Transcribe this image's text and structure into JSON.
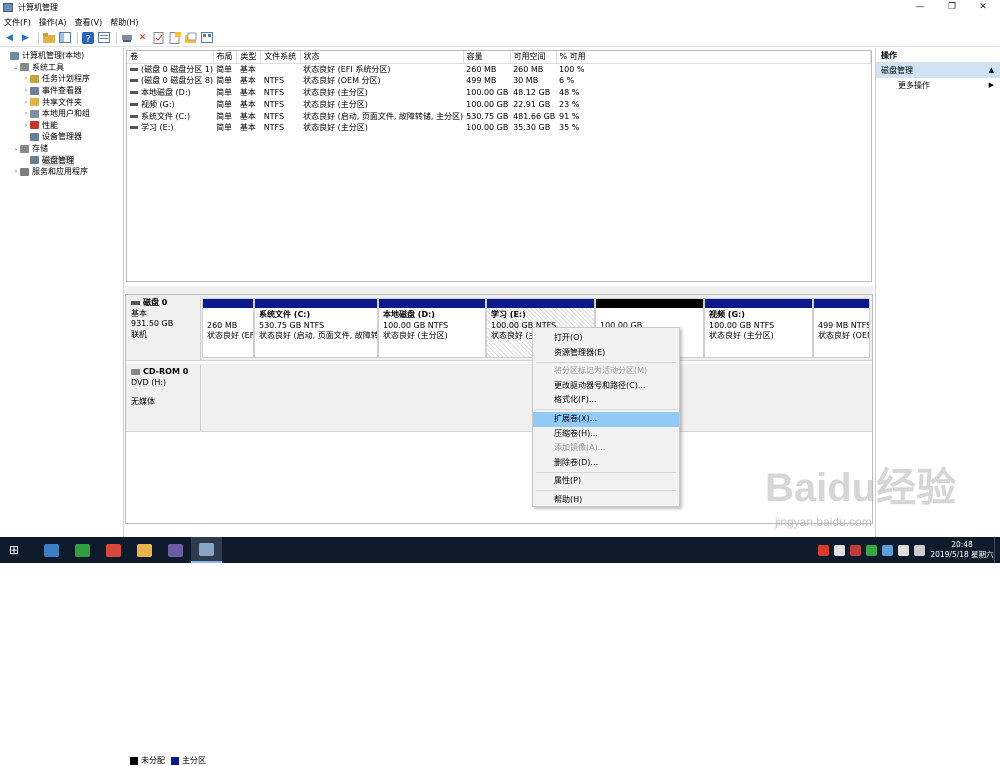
{
  "window": {
    "title": "计算机管理"
  },
  "window_controls": {
    "minimize": "—",
    "maximize": "❐",
    "close": "✕"
  },
  "menu": [
    "文件(F)",
    "操作(A)",
    "查看(V)",
    "帮助(H)"
  ],
  "tree": [
    {
      "label": "计算机管理(本地)",
      "indent": 0,
      "twisty": "",
      "icon": "computer-icon",
      "color": "#6f8aa6"
    },
    {
      "label": "系统工具",
      "indent": 1,
      "twisty": "⌄",
      "icon": "tools-icon",
      "color": "#8a8a8a"
    },
    {
      "label": "任务计划程序",
      "indent": 2,
      "twisty": "›",
      "icon": "clock-icon",
      "color": "#c9a23a"
    },
    {
      "label": "事件查看器",
      "indent": 2,
      "twisty": "›",
      "icon": "event-icon",
      "color": "#6d7f99"
    },
    {
      "label": "共享文件夹",
      "indent": 2,
      "twisty": "›",
      "icon": "folder-icon",
      "color": "#e2b34a"
    },
    {
      "label": "本地用户和组",
      "indent": 2,
      "twisty": "›",
      "icon": "users-icon",
      "color": "#7f8f9f"
    },
    {
      "label": "性能",
      "indent": 2,
      "twisty": "›",
      "icon": "performance-icon",
      "color": "#c0392b"
    },
    {
      "label": "设备管理器",
      "indent": 2,
      "twisty": "",
      "icon": "device-icon",
      "color": "#5f7f9f"
    },
    {
      "label": "存储",
      "indent": 1,
      "twisty": "⌄",
      "icon": "storage-icon",
      "color": "#8a8a8a"
    },
    {
      "label": "磁盘管理",
      "indent": 2,
      "twisty": "",
      "icon": "disk-icon",
      "color": "#6d7d8d",
      "selected": true
    },
    {
      "label": "服务和应用程序",
      "indent": 1,
      "twisty": "›",
      "icon": "services-icon",
      "color": "#7f7f7f"
    }
  ],
  "volumes": {
    "columns": [
      "卷",
      "布局",
      "类型",
      "文件系统",
      "状态",
      "容量",
      "可用空间",
      "% 可用"
    ],
    "rows": [
      [
        "(磁盘 0 磁盘分区 1)",
        "简单",
        "基本",
        "",
        "状态良好 (EFI 系统分区)",
        "260 MB",
        "260 MB",
        "100 %"
      ],
      [
        "(磁盘 0 磁盘分区 8)",
        "简单",
        "基本",
        "NTFS",
        "状态良好 (OEM 分区)",
        "499 MB",
        "30 MB",
        "6 %"
      ],
      [
        "本地磁盘 (D:)",
        "简单",
        "基本",
        "NTFS",
        "状态良好 (主分区)",
        "100.00 GB",
        "48.12 GB",
        "48 %"
      ],
      [
        "视频 (G:)",
        "简单",
        "基本",
        "NTFS",
        "状态良好 (主分区)",
        "100.00 GB",
        "22.91 GB",
        "23 %"
      ],
      [
        "系统文件 (C:)",
        "简单",
        "基本",
        "NTFS",
        "状态良好 (启动, 页面文件, 故障转储, 主分区)",
        "530.75 GB",
        "481.66 GB",
        "91 %"
      ],
      [
        "学习 (E:)",
        "简单",
        "基本",
        "NTFS",
        "状态良好 (主分区)",
        "100.00 GB",
        "35.30 GB",
        "35 %"
      ]
    ]
  },
  "disk0": {
    "name": "磁盘 0",
    "type": "基本",
    "size": "931.50 GB",
    "status": "联机",
    "partitions": [
      {
        "name": "",
        "size": "260 MB",
        "status": "状态良好 (EFI",
        "bar": "#0b1a8a"
      },
      {
        "name": "系统文件 (C:)",
        "size": "530.75 GB NTFS",
        "status": "状态良好 (启动, 页面文件, 故障转",
        "bar": "#0b1a8a"
      },
      {
        "name": "本地磁盘 (D:)",
        "size": "100.00 GB NTFS",
        "status": "状态良好 (主分区)",
        "bar": "#0b1a8a"
      },
      {
        "name": "学习 (E:)",
        "size": "100.00 GB NTFS",
        "status": "状态良好 (主",
        "bar": "#0b1a8a",
        "hatched": true
      },
      {
        "name": "",
        "size": "100.00 GB",
        "status": "",
        "bar": "#000000"
      },
      {
        "name": "视频 (G:)",
        "size": "100.00 GB NTFS",
        "status": "状态良好 (主分区)",
        "bar": "#0b1a8a"
      },
      {
        "name": "",
        "size": "499 MB NTFS",
        "status": "状态良好 (OEM",
        "bar": "#0b1a8a"
      }
    ]
  },
  "cdrom": {
    "name": "CD-ROM 0",
    "type": "DVD (H:)",
    "media": "无媒体"
  },
  "legend": [
    {
      "label": "未分配",
      "color": "#000000"
    },
    {
      "label": "主分区",
      "color": "#0b1a8a"
    }
  ],
  "actions": {
    "header": "操作",
    "section": "磁盘管理",
    "section_arrow": "▲",
    "more": "更多操作",
    "more_arrow": "▶"
  },
  "context_menu": [
    {
      "label": "打开(O)",
      "state": "normal"
    },
    {
      "label": "资源管理器(E)",
      "state": "normal"
    },
    {
      "sep": true
    },
    {
      "label": "将分区标记为活动分区(M)",
      "state": "disabled"
    },
    {
      "label": "更改驱动器号和路径(C)...",
      "state": "normal"
    },
    {
      "label": "格式化(F)...",
      "state": "normal"
    },
    {
      "sep": true
    },
    {
      "label": "扩展卷(X)...",
      "state": "highlighted"
    },
    {
      "label": "压缩卷(H)...",
      "state": "normal"
    },
    {
      "label": "添加镜像(A)...",
      "state": "disabled"
    },
    {
      "label": "删除卷(D)...",
      "state": "normal"
    },
    {
      "sep": true
    },
    {
      "label": "属性(P)",
      "state": "normal"
    },
    {
      "sep": true
    },
    {
      "label": "帮助(H)",
      "state": "normal"
    }
  ],
  "taskbar": {
    "start": "⊞",
    "apps": [
      {
        "name": "explorer-app",
        "color": "#3a7fc1"
      },
      {
        "name": "browser-360-app",
        "color": "#2e9e3e"
      },
      {
        "name": "chrome-app",
        "color": "#d9473b"
      },
      {
        "name": "folder-app",
        "color": "#e5b54c"
      },
      {
        "name": "photos-app",
        "color": "#6b5ca5"
      },
      {
        "name": "computer-management-app",
        "color": "#8aa4c8",
        "active": true
      }
    ],
    "tray": [
      "#d63b2f",
      "#e0e0e0",
      "#c23b3b",
      "#3aa64a",
      "#5a9fd8",
      "#dddddd",
      "#cccccc"
    ],
    "time": "20:48",
    "date": "2019/5/18 星期六"
  },
  "watermark": {
    "logo": "Baidu经验",
    "url": "jingyan.baidu.com"
  }
}
